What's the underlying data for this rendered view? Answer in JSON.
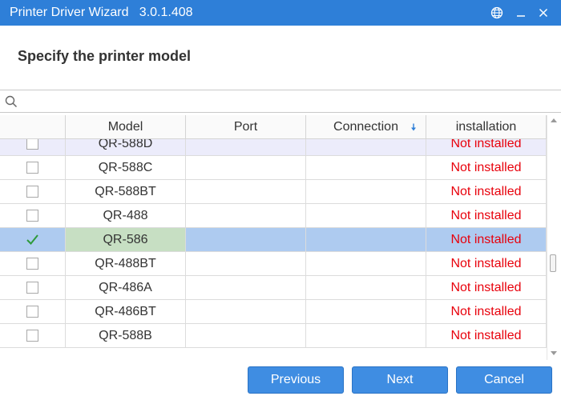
{
  "window": {
    "title": "Printer Driver Wizard   3.0.1.408",
    "icons": [
      "globe-icon",
      "minimize-icon",
      "close-icon"
    ],
    "accent_color": "#2e7fd8"
  },
  "heading": "Specify the printer model",
  "search": {
    "value": "",
    "placeholder": "",
    "icon": "search-icon"
  },
  "table": {
    "columns": [
      "",
      "Model",
      "Port",
      "Connection",
      "installation"
    ],
    "sort_column": "Connection",
    "sort_direction": "descending",
    "rows": [
      {
        "checked": false,
        "model": "QR-588D",
        "port": "",
        "connection": "",
        "installation": "Not installed",
        "state": "hover"
      },
      {
        "checked": false,
        "model": "QR-588C",
        "port": "",
        "connection": "",
        "installation": "Not installed",
        "state": ""
      },
      {
        "checked": false,
        "model": "QR-588BT",
        "port": "",
        "connection": "",
        "installation": "Not installed",
        "state": ""
      },
      {
        "checked": false,
        "model": "QR-488",
        "port": "",
        "connection": "",
        "installation": "Not installed",
        "state": ""
      },
      {
        "checked": true,
        "model": "QR-586",
        "port": "",
        "connection": "",
        "installation": "Not installed",
        "state": "selected"
      },
      {
        "checked": false,
        "model": "QR-488BT",
        "port": "",
        "connection": "",
        "installation": "Not installed",
        "state": ""
      },
      {
        "checked": false,
        "model": "QR-486A",
        "port": "",
        "connection": "",
        "installation": "Not installed",
        "state": ""
      },
      {
        "checked": false,
        "model": "QR-486BT",
        "port": "",
        "connection": "",
        "installation": "Not installed",
        "state": ""
      },
      {
        "checked": false,
        "model": "QR-588B",
        "port": "",
        "connection": "",
        "installation": "Not installed",
        "state": ""
      }
    ],
    "status_color": "#e8000b",
    "selected_row_color": "#aecbf0"
  },
  "buttons": {
    "previous": "Previous",
    "next": "Next",
    "cancel": "Cancel"
  }
}
